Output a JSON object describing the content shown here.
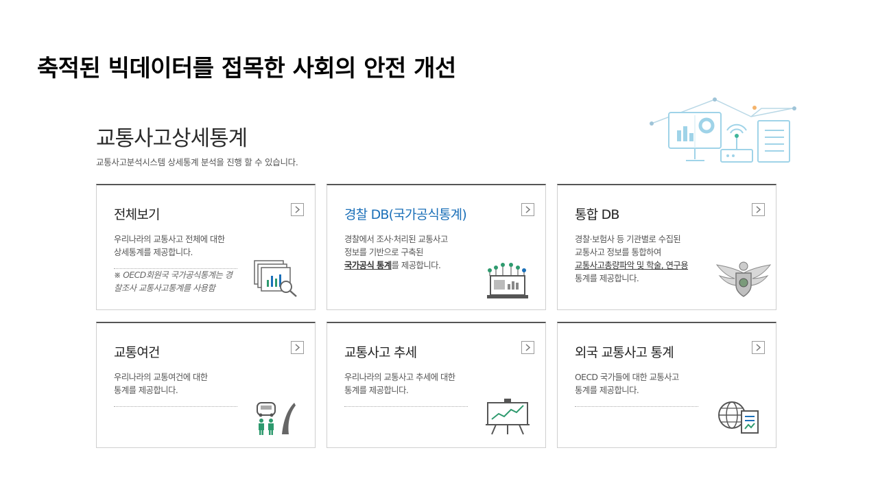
{
  "slide": {
    "title": "축적된 빅데이터를 접목한 사회의 안전 개선"
  },
  "page": {
    "heading": "교통사고상세통계",
    "subheading": "교통사고분석시스템 상세통계 분석을 진행 할 수 있습니다."
  },
  "cards": [
    {
      "title": "전체보기",
      "desc": [
        "우리나라의 교통사고 전체에 대한",
        "상세통계를 제공합니다."
      ],
      "note": [
        "※ OECD회원국 국가공식통계는 경",
        "찰조사 교통사고통계를 사용함"
      ],
      "icon": "chart-magnifier-icon"
    },
    {
      "title": "경찰 DB(국가공식통계)",
      "desc_line1": "경찰에서 조사·처리된 교통사고",
      "desc_line2": "정보를 기반으로 구축된",
      "desc_line3_em": "국가공식 통계",
      "desc_line3_rest": "를 제공합니다.",
      "icon": "laptop-network-icon"
    },
    {
      "title": "통합 DB",
      "desc_line1": "경찰·보험사 등 기관별로 수집된",
      "desc_line2": "교통사고 정보를 통합하여",
      "desc_line3_u": "교통사고총량파악 및 학술, 연구용",
      "desc_line4": "통계를 제공합니다.",
      "icon": "police-emblem-icon"
    },
    {
      "title": "교통여건",
      "desc": [
        "우리나라의 교통여건에 대한",
        "통계를 제공합니다."
      ],
      "icon": "road-pedestrian-icon"
    },
    {
      "title": "교통사고 추세",
      "desc": [
        "우리나라의 교통사고 추세에 대한",
        "통계를 제공합니다."
      ],
      "icon": "trend-board-icon"
    },
    {
      "title": "외국 교통사고 통계",
      "desc": [
        "OECD 국가들에 대한 교통사고",
        "통계를 제공합니다."
      ],
      "icon": "globe-report-icon"
    }
  ],
  "colors": {
    "accent_blue": "#1a6fb8",
    "icon_green": "#2e9a6e",
    "hero_blue": "#9fd3e8"
  }
}
